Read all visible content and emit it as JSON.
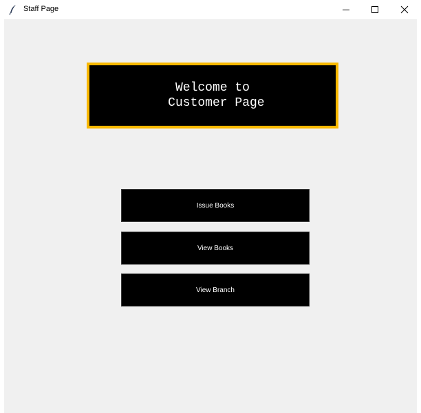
{
  "window": {
    "title": "Staff Page",
    "icon": "feather-icon",
    "controls": [
      "minimize-icon",
      "maximize-icon",
      "close-icon"
    ]
  },
  "heading": {
    "text": "Welcome to\n Customer Page",
    "colors": {
      "background": "#000000",
      "border": "#f9b800",
      "text": "#ffffff"
    }
  },
  "buttons": {
    "issue_books": "Issue Books",
    "view_books": "View Books",
    "view_branch": "View Branch"
  },
  "colors": {
    "client_background": "#f0f0f0",
    "button_background": "#000000",
    "button_text": "#ffffff"
  }
}
